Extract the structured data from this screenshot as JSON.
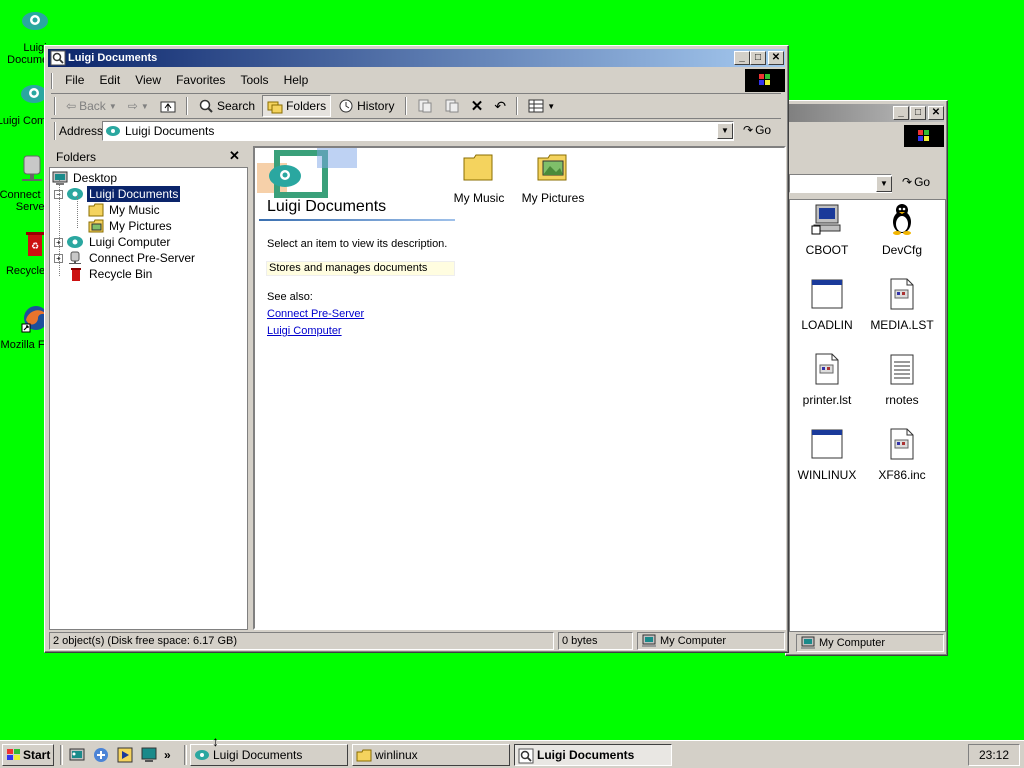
{
  "desktop": {
    "icons": [
      {
        "label": "Luigi Documents",
        "icon": "cloud-folder-icon"
      },
      {
        "label": "Luigi Computer",
        "icon": "cloud-computer-icon"
      },
      {
        "label": "Connect Pre-Server",
        "icon": "network-drive-icon"
      },
      {
        "label": "Recycle Bin",
        "icon": "recycle-bin-icon"
      },
      {
        "label": "Mozilla Firefox",
        "icon": "firefox-icon"
      }
    ]
  },
  "back_window": {
    "title": "winlinux",
    "go_label": "Go",
    "status": "My Computer",
    "files": [
      {
        "label": "CBOOT",
        "icon": "computer-shortcut-icon"
      },
      {
        "label": "DevCfg",
        "icon": "penguin-icon"
      },
      {
        "label": "LOADLIN",
        "icon": "window-app-icon"
      },
      {
        "label": "MEDIA.LST",
        "icon": "text-file-icon"
      },
      {
        "label": "printer.lst",
        "icon": "text-file-icon"
      },
      {
        "label": "rnotes",
        "icon": "notepad-file-icon"
      },
      {
        "label": "WINLINUX",
        "icon": "window-app-icon"
      },
      {
        "label": "XF86.inc",
        "icon": "text-file-icon"
      }
    ]
  },
  "main_window": {
    "title": "Luigi Documents",
    "menu": [
      "File",
      "Edit",
      "View",
      "Favorites",
      "Tools",
      "Help"
    ],
    "toolbar": {
      "back": "Back",
      "search": "Search",
      "folders": "Folders",
      "history": "History"
    },
    "address": {
      "label": "Address",
      "value": "Luigi Documents",
      "go": "Go"
    },
    "folders_pane": {
      "title": "Folders",
      "tree": [
        {
          "label": "Desktop",
          "depth": 0,
          "selected": false,
          "icon": "desktop-icon"
        },
        {
          "label": "Luigi Documents",
          "depth": 1,
          "selected": true,
          "icon": "cloud-folder-icon"
        },
        {
          "label": "My Music",
          "depth": 2,
          "selected": false,
          "icon": "folder-icon"
        },
        {
          "label": "My Pictures",
          "depth": 2,
          "selected": false,
          "icon": "pictures-folder-icon"
        },
        {
          "label": "Luigi Computer",
          "depth": 1,
          "selected": false,
          "icon": "cloud-computer-icon"
        },
        {
          "label": "Connect Pre-Server",
          "depth": 1,
          "selected": false,
          "icon": "network-drive-icon"
        },
        {
          "label": "Recycle Bin",
          "depth": 1,
          "selected": false,
          "icon": "recycle-bin-icon"
        }
      ]
    },
    "info_panel": {
      "heading": "Luigi Documents",
      "select_hint": "Select an item to view its description.",
      "description": "Stores and manages documents",
      "see_also": "See also:",
      "links": [
        "Connect Pre-Server",
        "Luigi Computer"
      ]
    },
    "items": [
      {
        "label": "My Music",
        "icon": "folder-icon"
      },
      {
        "label": "My Pictures",
        "icon": "pictures-folder-icon"
      }
    ],
    "status": {
      "objects": "2 object(s) (Disk free space: 6.17 GB)",
      "size": "0 bytes",
      "zone": "My Computer"
    }
  },
  "taskbar": {
    "start": "Start",
    "tasks": [
      {
        "label": "Luigi Documents",
        "active": false
      },
      {
        "label": "winlinux",
        "active": false
      },
      {
        "label": "Luigi Documents",
        "active": true
      }
    ],
    "clock": "23:12"
  }
}
